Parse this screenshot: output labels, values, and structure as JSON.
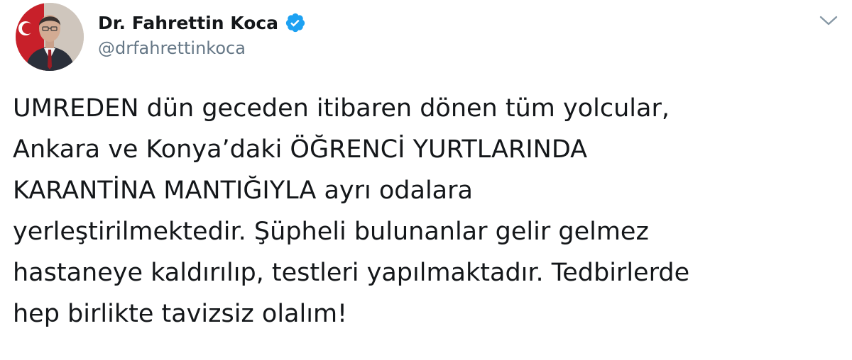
{
  "author": {
    "display_name": "Dr. Fahrettin Koca",
    "handle": "@drfahrettinkoca",
    "verified": true,
    "verified_color": "#1da1f2"
  },
  "icons": {
    "avatar": "profile-photo",
    "verified": "verified-badge-icon",
    "menu": "chevron-down-icon"
  },
  "tweet": {
    "lines": [
      "UMREDEN dün geceden itibaren dönen tüm yolcular,",
      "Ankara ve Konya’daki ÖĞRENCİ YURTLARINDA",
      "KARANTİNA MANTIĞIYLA ayrı odalara",
      "yerleştirilmektedir. Şüpheli bulunanlar gelir gelmez",
      "hastaneye kaldırılıp, testleri yapılmaktadır. Tedbirlerde",
      "hep birlikte tavizsiz olalım!"
    ]
  },
  "colors": {
    "text": "#14171a",
    "secondary": "#657786",
    "accent": "#1da1f2"
  }
}
